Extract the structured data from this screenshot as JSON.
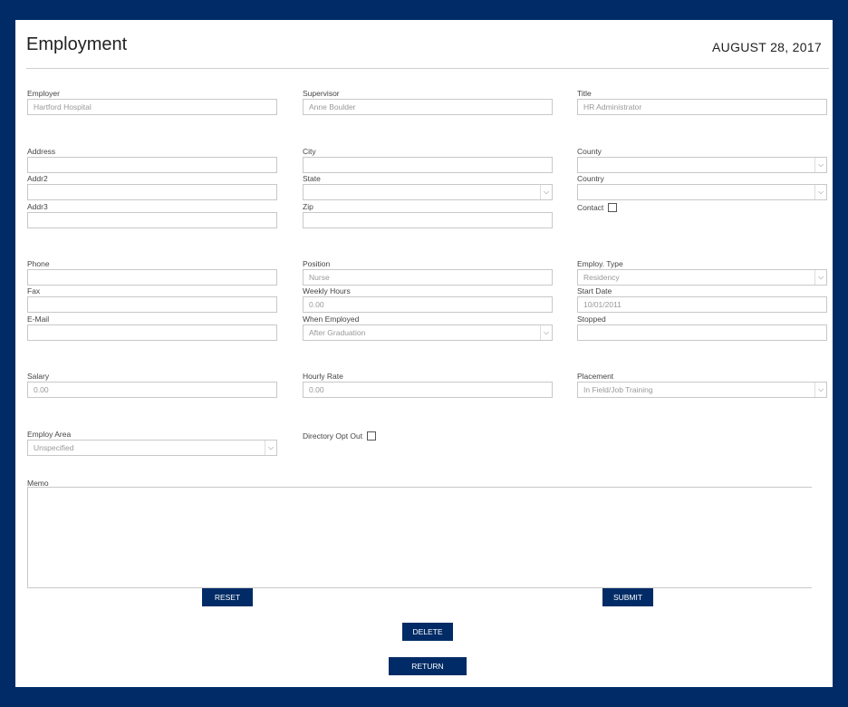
{
  "header": {
    "title": "Employment",
    "date": "AUGUST 28, 2017"
  },
  "fields": {
    "employer": {
      "label": "Employer",
      "value": "Hartford Hospital"
    },
    "supervisor": {
      "label": "Supervisor",
      "value": "Anne Boulder"
    },
    "title": {
      "label": "Title",
      "value": "HR Administrator"
    },
    "address": {
      "label": "Address",
      "value": ""
    },
    "city": {
      "label": "City",
      "value": ""
    },
    "county": {
      "label": "County",
      "value": ""
    },
    "addr2": {
      "label": "Addr2",
      "value": ""
    },
    "state": {
      "label": "State",
      "value": ""
    },
    "country": {
      "label": "Country",
      "value": ""
    },
    "addr3": {
      "label": "Addr3",
      "value": ""
    },
    "zip": {
      "label": "Zip",
      "value": ""
    },
    "contact": {
      "label": "Contact"
    },
    "phone": {
      "label": "Phone",
      "value": ""
    },
    "position": {
      "label": "Position",
      "value": "Nurse"
    },
    "employ_type": {
      "label": "Employ. Type",
      "value": "Residency"
    },
    "fax": {
      "label": "Fax",
      "value": ""
    },
    "weekly_hours": {
      "label": "Weekly Hours",
      "value": "0.00"
    },
    "start_date": {
      "label": "Start Date",
      "value": "10/01/2011"
    },
    "email": {
      "label": "E-Mail",
      "value": ""
    },
    "when_employed": {
      "label": "When Employed",
      "value": "After Graduation"
    },
    "stopped": {
      "label": "Stopped",
      "value": ""
    },
    "salary": {
      "label": "Salary",
      "value": "0.00"
    },
    "hourly_rate": {
      "label": "Hourly Rate",
      "value": "0.00"
    },
    "placement": {
      "label": "Placement",
      "value": "In Field/Job Training"
    },
    "employ_area": {
      "label": "Employ Area",
      "value": "Unspecified"
    },
    "directory_opt_out": {
      "label": "Directory Opt Out"
    },
    "memo": {
      "label": "Memo",
      "value": ""
    }
  },
  "buttons": {
    "reset": "RESET",
    "submit": "SUBMIT",
    "delete": "DELETE",
    "return": "RETURN"
  },
  "icons": {
    "dropdown": "chevron-down-icon"
  },
  "colors": {
    "brand": "#002b66",
    "background": "#ffffff"
  }
}
